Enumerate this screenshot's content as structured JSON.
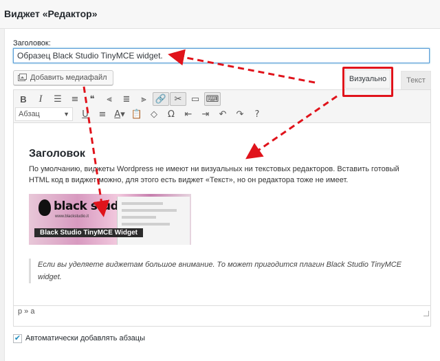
{
  "widget": {
    "title": "Виджет «Редактор»"
  },
  "form": {
    "title_label": "Заголовок:",
    "title_value": "Образец Black Studio TinyMCE widget.",
    "add_media_label": "Добавить медиафайл",
    "tab_visual": "Визуально",
    "tab_text": "Текст",
    "format_select": "Абзац",
    "auto_paragraph_label": "Автоматически добавлять абзацы",
    "auto_paragraph_checked": true
  },
  "toolbar": {
    "row1": [
      "bold-icon",
      "italic-icon",
      "bullet-list-icon",
      "numbered-list-icon",
      "blockquote-icon",
      "align-left-icon",
      "align-center-icon",
      "align-right-icon",
      "link-icon",
      "unlink-icon",
      "read-more-icon",
      "toolbar-toggle-icon"
    ],
    "row2": [
      "underline-icon",
      "justify-icon",
      "text-color-icon",
      "paste-text-icon",
      "clear-format-icon",
      "special-char-icon",
      "outdent-icon",
      "indent-icon",
      "undo-icon",
      "redo-icon",
      "help-icon"
    ]
  },
  "content": {
    "heading": "Заголовок",
    "paragraph": "По умолчанию, виджеты Wordpress не имеют ни визуальных ни текстовых редакторов. Вставить готовый HTML код в виджет можно, для этого есть виджет «Текст», но он редактора тоже не имеет.",
    "image_logo": "black studio",
    "image_logo_sub": "www.blackstudio.it",
    "image_caption": "Black Studio TinyMCE Widget",
    "quote": "Если вы уделяете виджетам большое внимание. То может пригодится плагин Black Studio TinyMCE widget."
  },
  "status_bar": {
    "path": "p » a"
  },
  "colors": {
    "highlight": "#e0131b",
    "focus": "#5b9dd9"
  }
}
